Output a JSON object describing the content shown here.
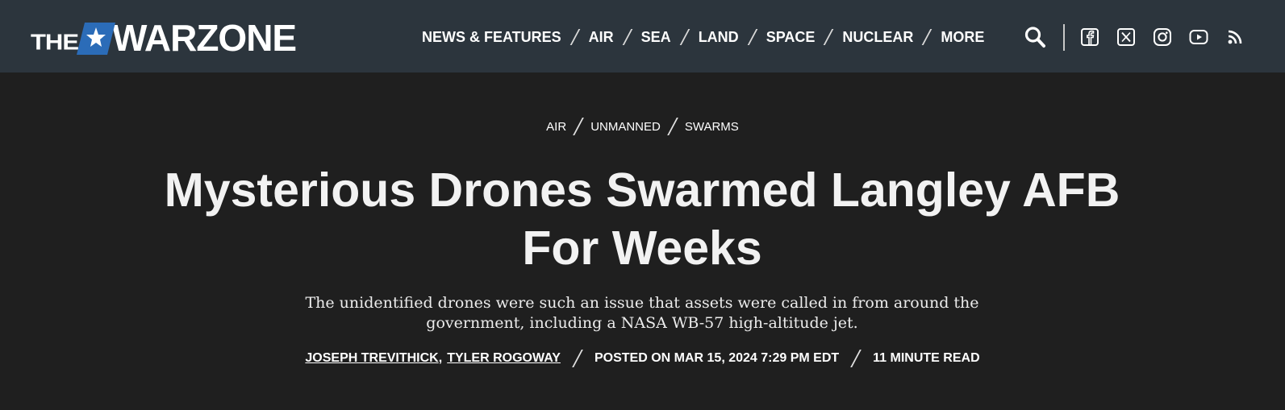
{
  "brand": {
    "logo_the": "THE",
    "logo_main": "WARZONE",
    "star_color": "#2b6cb8"
  },
  "nav": {
    "items": [
      {
        "label": "NEWS & FEATURES"
      },
      {
        "label": "AIR"
      },
      {
        "label": "SEA"
      },
      {
        "label": "LAND"
      },
      {
        "label": "SPACE"
      },
      {
        "label": "NUCLEAR"
      },
      {
        "label": "MORE"
      }
    ]
  },
  "icons": {
    "search": "search-icon",
    "social": [
      "facebook-icon",
      "x-twitter-icon",
      "instagram-icon",
      "youtube-icon",
      "rss-icon"
    ]
  },
  "breadcrumb": {
    "items": [
      {
        "label": "AIR"
      },
      {
        "label": "UNMANNED"
      },
      {
        "label": "SWARMS"
      }
    ]
  },
  "article": {
    "headline": "Mysterious Drones Swarmed Langley AFB For Weeks",
    "dek": "The unidentified drones were such an issue that assets were called in from around the government, including a NASA WB-57 high-altitude jet.",
    "authors": [
      {
        "name": "JOSEPH TREVITHICK"
      },
      {
        "name": "TYLER ROGOWAY"
      }
    ],
    "author_separator": ",",
    "posted": "POSTED ON MAR 15, 2024 7:29 PM EDT",
    "read_time": "11 MINUTE READ"
  },
  "colors": {
    "header_bg": "#2c353d",
    "page_bg": "#1f1f1f",
    "text": "#ffffff"
  }
}
